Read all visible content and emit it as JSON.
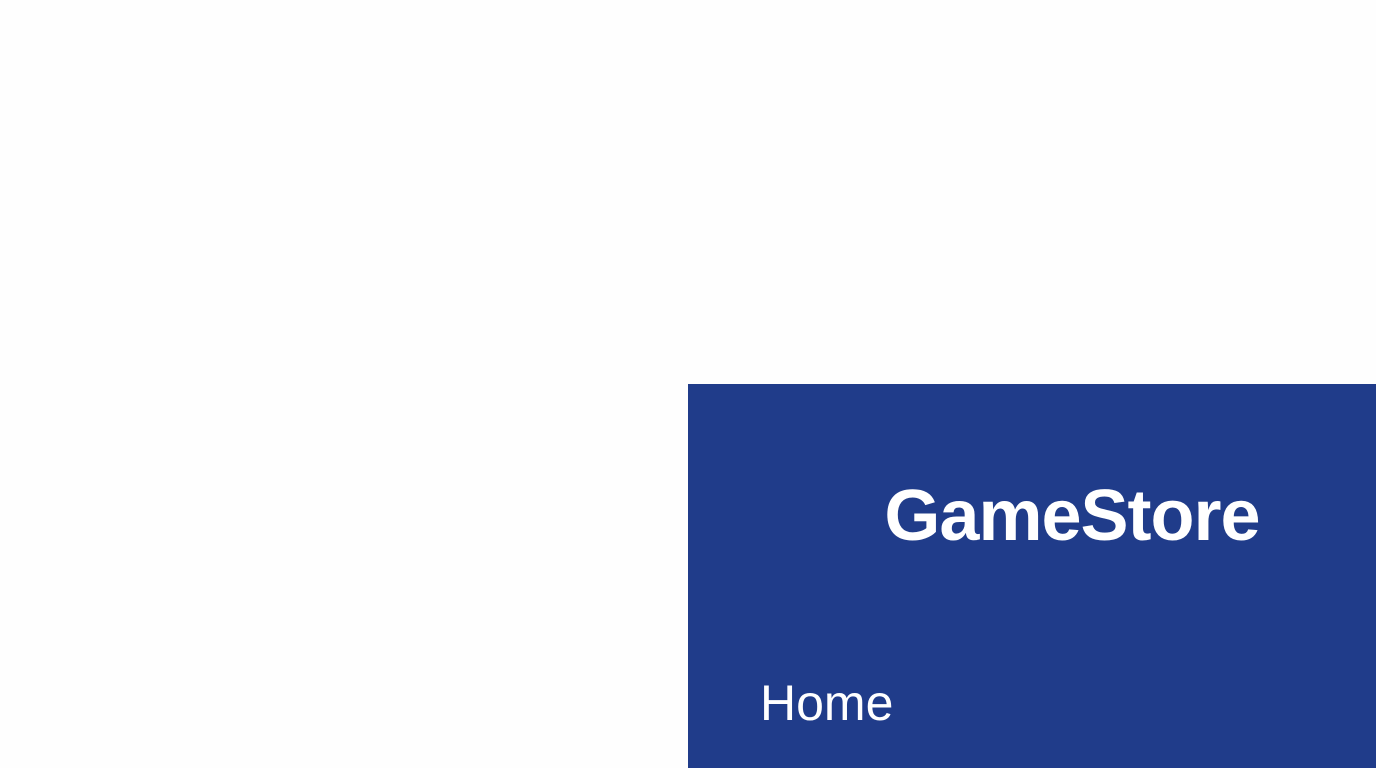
{
  "app": {
    "brand": "GameStore"
  },
  "nav": {
    "items": [
      {
        "label": "Home"
      }
    ]
  },
  "colors": {
    "page_background": "#fefefe",
    "sidebar_background": "#203c8a",
    "sidebar_text": "#ffffff"
  }
}
